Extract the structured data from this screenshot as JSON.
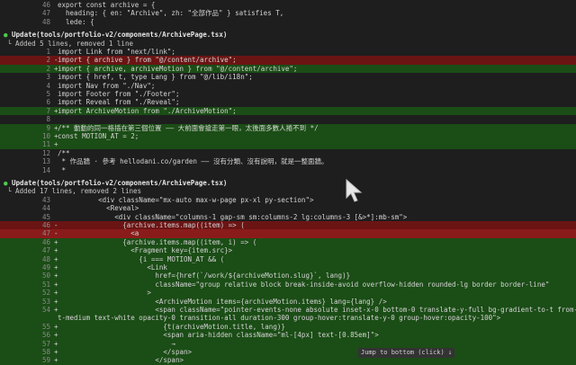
{
  "top_lines": [
    {
      "ln": "46",
      "sign": "",
      "code": "export const archive = {"
    },
    {
      "ln": "47",
      "sign": "",
      "code": "  heading: { en: \"Archive\", zh: \"全部作品\" } satisfies T,"
    },
    {
      "ln": "48",
      "sign": "",
      "code": "  lede: {"
    }
  ],
  "update1": {
    "bullet": "●",
    "title": "Update(tools/portfolio-v2/components/ArchivePage.tsx)",
    "summary": "└ Added 5 lines, removed 1 line"
  },
  "diff1": [
    {
      "ln": "1",
      "sign": "",
      "type": "ctx",
      "code": "import Link from \"next/link\";"
    },
    {
      "ln": "2",
      "sign": "-",
      "type": "del",
      "code": "import { archive } from \"@/content/archive\";"
    },
    {
      "ln": "2",
      "sign": "+",
      "type": "add",
      "code": "import { archive, archiveMotion } from \"@/content/archive\";"
    },
    {
      "ln": "3",
      "sign": "",
      "type": "ctx",
      "code": "import { href, t, type Lang } from \"@/lib/i18n\";"
    },
    {
      "ln": "4",
      "sign": "",
      "type": "ctx",
      "code": "import Nav from \"./Nav\";"
    },
    {
      "ln": "5",
      "sign": "",
      "type": "ctx",
      "code": "import Footer from \"./Footer\";"
    },
    {
      "ln": "6",
      "sign": "",
      "type": "ctx",
      "code": "import Reveal from \"./Reveal\";"
    },
    {
      "ln": "7",
      "sign": "+",
      "type": "add",
      "code": "import ArchiveMotion from \"./ArchiveMotion\";"
    },
    {
      "ln": "8",
      "sign": "",
      "type": "ctx",
      "code": ""
    },
    {
      "ln": "9",
      "sign": "+",
      "type": "add",
      "code": "/** 動動的同一格插在第三個位置 —— 大前面會搶走第一眼，太後面多數人捲不到 */"
    },
    {
      "ln": "10",
      "sign": "+",
      "type": "add",
      "code": "const MOTION_AT = 2;"
    },
    {
      "ln": "11",
      "sign": "+",
      "type": "add",
      "code": ""
    },
    {
      "ln": "12",
      "sign": "",
      "type": "ctx",
      "code": "/**"
    },
    {
      "ln": "13",
      "sign": "",
      "type": "ctx",
      "code": " * 作品牆 · 參考 hellodani.co/garden —— 沒有分類、沒有說明，就是一整面牆。"
    },
    {
      "ln": "14",
      "sign": "",
      "type": "ctx",
      "code": " *"
    }
  ],
  "update2": {
    "bullet": "●",
    "title": "Update(tools/portfolio-v2/components/ArchivePage.tsx)",
    "summary": "└ Added 17 lines, removed 2 lines"
  },
  "diff2": [
    {
      "ln": "43",
      "sign": "",
      "type": "ctx",
      "code": "          <div className=\"mx-auto max-w-page px-xl py-section\">"
    },
    {
      "ln": "44",
      "sign": "",
      "type": "ctx",
      "code": "            <Reveal>"
    },
    {
      "ln": "45",
      "sign": "",
      "type": "ctx",
      "code": "              <div className=\"columns-1 gap-sm sm:columns-2 lg:columns-3 [&>*]:mb-sm\">"
    },
    {
      "ln": "46",
      "sign": "-",
      "type": "del",
      "code": "                {archive.items.map((item) => ("
    },
    {
      "ln": "47",
      "sign": "-",
      "type": "del2",
      "code": "                  <a"
    },
    {
      "ln": "46",
      "sign": "+",
      "type": "add",
      "code": "                {archive.items.map((item, i) => ("
    },
    {
      "ln": "47",
      "sign": "+",
      "type": "add",
      "code": "                  <Fragment key={item.src}>"
    },
    {
      "ln": "48",
      "sign": "+",
      "type": "add",
      "code": "                    {i === MOTION_AT && ("
    },
    {
      "ln": "49",
      "sign": "+",
      "type": "add",
      "code": "                      <Link"
    },
    {
      "ln": "50",
      "sign": "+",
      "type": "add",
      "code": "                        href={href(`/work/${archiveMotion.slug}`, lang)}"
    },
    {
      "ln": "51",
      "sign": "+",
      "type": "add",
      "code": "                        className=\"group relative block break-inside-avoid overflow-hidden rounded-lg border border-line\""
    },
    {
      "ln": "52",
      "sign": "+",
      "type": "add",
      "code": "                      >"
    },
    {
      "ln": "53",
      "sign": "+",
      "type": "add",
      "code": "                        <ArchiveMotion items={archiveMotion.items} lang={lang} />"
    },
    {
      "ln": "54",
      "sign": "+",
      "type": "add",
      "code": "                        <span className=\"pointer-events-none absolute inset-x-0 bottom-0 translate-y-full bg-gradient-to-t from-black/"
    },
    {
      "ln": "",
      "sign": "",
      "type": "add",
      "code": "t-medium text-white opacity-0 transition-all duration-300 group-hover:translate-y-0 group-hover:opacity-100\">"
    },
    {
      "ln": "55",
      "sign": "+",
      "type": "add",
      "code": "                          {t(archiveMotion.title, lang)}"
    },
    {
      "ln": "56",
      "sign": "+",
      "type": "add",
      "code": "                          <span aria-hidden className=\"ml-[4px] text-[0.85em]\">"
    },
    {
      "ln": "57",
      "sign": "+",
      "type": "add",
      "code": "                            →"
    },
    {
      "ln": "58",
      "sign": "+",
      "type": "add",
      "code": "                          </span>"
    },
    {
      "ln": "59",
      "sign": "+",
      "type": "add",
      "code": "                        </span>"
    }
  ],
  "jump_button": "Jump to bottom (click) ↓",
  "colors": {
    "bg": "#1e1e1e",
    "added": "#1b4d16",
    "removed": "#6b1414",
    "bullet": "#4ec94e"
  }
}
